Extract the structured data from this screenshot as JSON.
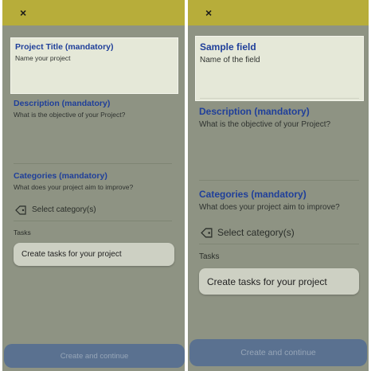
{
  "left": {
    "close_glyph": "×",
    "title_field": {
      "label": "Project Title (mandatory)",
      "placeholder": "Name your project"
    },
    "description_field": {
      "label": "Description (mandatory)",
      "help": "What is the objective of your Project?"
    },
    "categories_field": {
      "label": "Categories (mandatory)",
      "help": "What does your project aim to improve?",
      "select_label": "Select category(s)"
    },
    "tasks": {
      "label": "Tasks",
      "button": "Create tasks for your project"
    },
    "create_button": "Create and continue"
  },
  "right": {
    "close_glyph": "×",
    "sample_field": {
      "label": "Sample field",
      "placeholder": "Name of the field"
    },
    "description_field": {
      "label": "Description (mandatory)",
      "help": "What is the objective of your Project?"
    },
    "categories_field": {
      "label": "Categories (mandatory)",
      "help": "What does your project aim to improve?",
      "select_label": "Select category(s)"
    },
    "tasks": {
      "label": "Tasks",
      "button": "Create tasks for your project"
    },
    "create_button": "Create and continue"
  },
  "colors": {
    "overlay": "#8e9383",
    "topbar": "#b7ad3a",
    "highlight": "#e5e8d8",
    "label_blue": "#1f3f9a",
    "primary_button": "#5a7190"
  },
  "icons": [
    "close-icon",
    "tag-icon"
  ]
}
